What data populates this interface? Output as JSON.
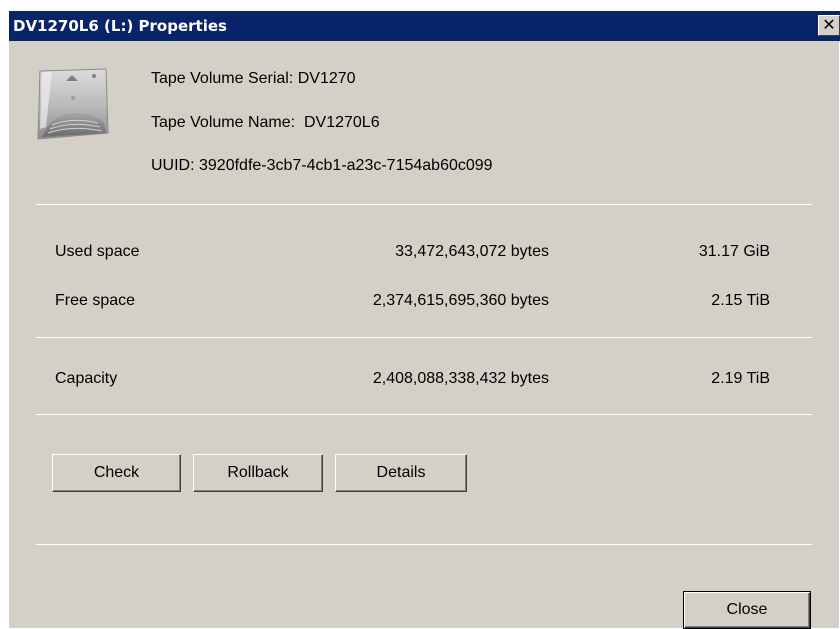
{
  "window": {
    "title": "DV1270L6 (L:) Properties",
    "close_glyph": "✕"
  },
  "header": {
    "serial": "Tape Volume Serial: DV1270",
    "name": "Tape Volume Name:  DV1270L6",
    "uuid": "UUID: 3920fdfe-3cb7-4cb1-a23c-7154ab60c099"
  },
  "space": {
    "used": {
      "label": "Used space",
      "bytes": "33,472,643,072 bytes",
      "human": "31.17 GiB"
    },
    "free": {
      "label": "Free space",
      "bytes": "2,374,615,695,360 bytes",
      "human": "2.15 TiB"
    },
    "capacity": {
      "label": "Capacity",
      "bytes": "2,408,088,338,432 bytes",
      "human": "2.19 TiB"
    }
  },
  "buttons": {
    "check": "Check",
    "rollback": "Rollback",
    "details": "Details",
    "close": "Close"
  },
  "icons": {
    "tape": "tape-cartridge-icon"
  },
  "colors": {
    "titlebar": "#0a246a",
    "dialog_bg": "#d4d0c8"
  }
}
